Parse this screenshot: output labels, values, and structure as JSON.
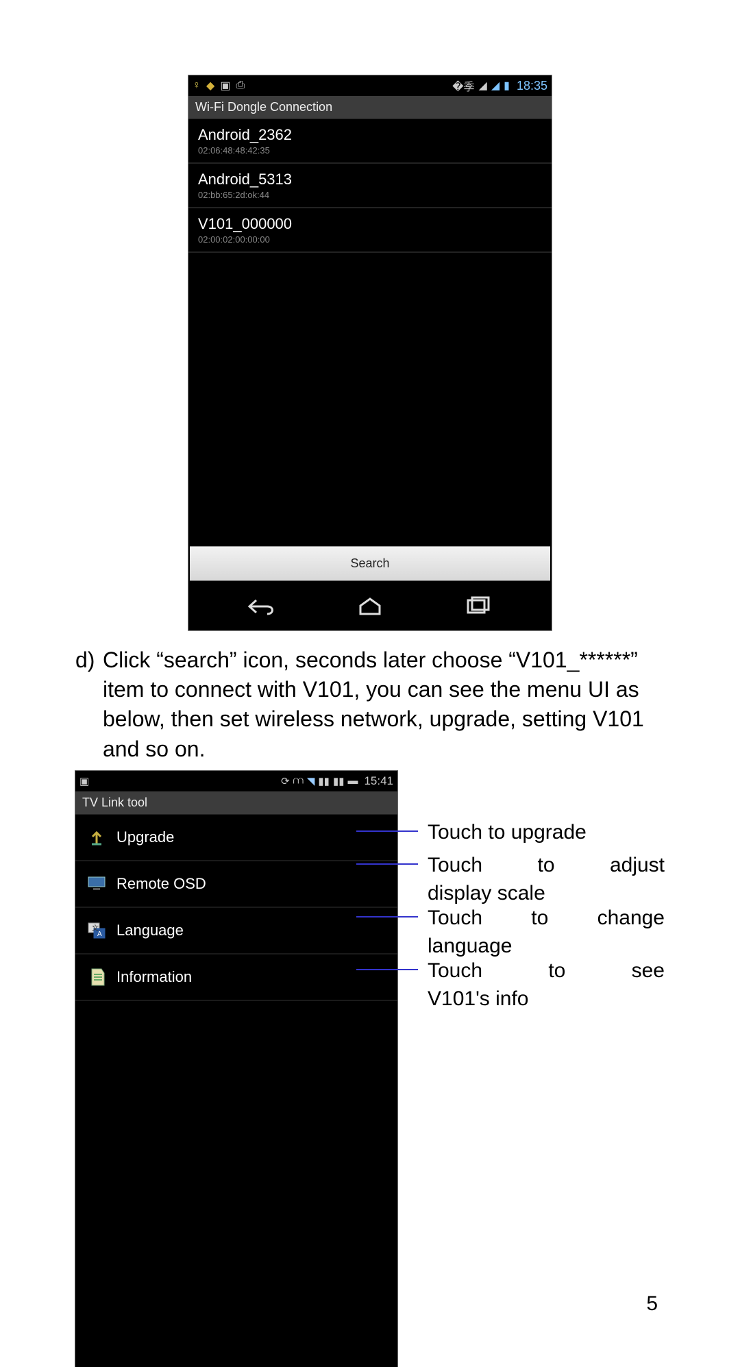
{
  "shot1": {
    "status": {
      "time": "18:35"
    },
    "title": "Wi-Fi Dongle Connection",
    "devices": [
      {
        "name": "Android_2362",
        "mac": "02:06:48:48:42:35"
      },
      {
        "name": "Android_5313",
        "mac": "02:bb:65:2d:ok:44"
      },
      {
        "name": "V101_000000",
        "mac": "02:00:02:00:00:00"
      }
    ],
    "search_label": "Search"
  },
  "instruction": {
    "marker": "d)",
    "text": "Click “search” icon, seconds later choose “V101_******” item to connect with V101, you can see the menu UI as below, then set wireless network, upgrade, setting V101 and so on."
  },
  "shot2": {
    "status": {
      "time": "15:41"
    },
    "title": "TV Link tool",
    "items": [
      {
        "label": "Upgrade"
      },
      {
        "label": "Remote OSD"
      },
      {
        "label": "Language"
      },
      {
        "label": "Information"
      }
    ]
  },
  "annotations": {
    "upgrade": "Touch to upgrade",
    "remote_l1": "Touch to adjust",
    "remote_l2": "display scale",
    "language_l1": "Touch to change",
    "language_l2": "language",
    "info_l1": "Touch to see",
    "info_l2": "V101's info"
  },
  "page_number": "5"
}
